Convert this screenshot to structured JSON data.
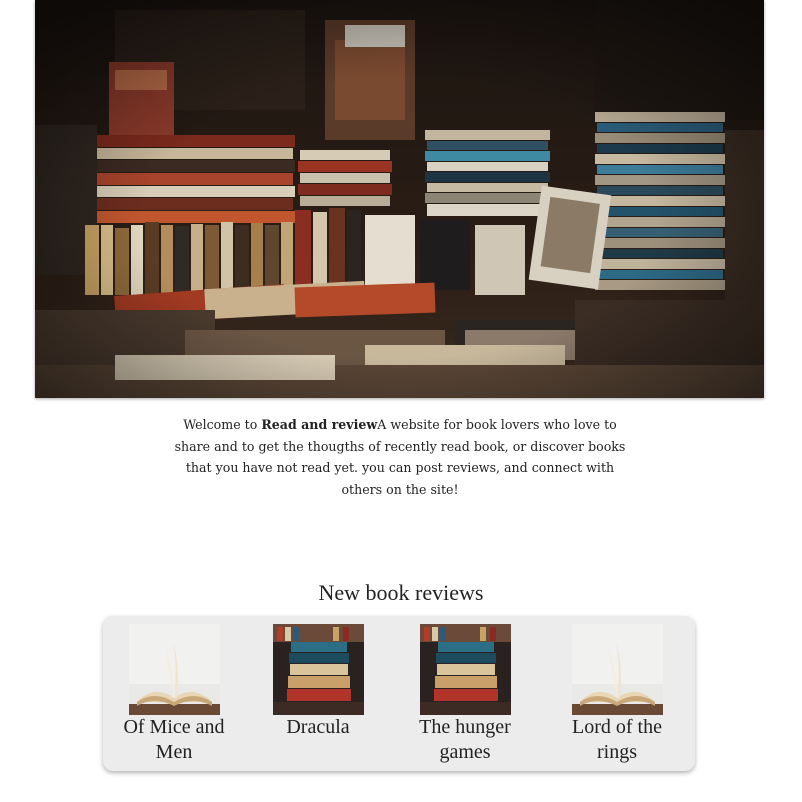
{
  "intro": {
    "prefix": "Welcome to ",
    "site_name": "Read and review",
    "text": "A website for book lovers who love to share and to get the thougths of recently read book, or discover books that you have not read yet. you can post reviews, and connect with others on the site!"
  },
  "hero": {
    "image": "bookstore-photo"
  },
  "reviews": {
    "heading": "New book reviews",
    "books": [
      {
        "title": "Of Mice and Men",
        "image": "open-book-photo"
      },
      {
        "title": "Dracula",
        "image": "book-stack-photo"
      },
      {
        "title": "The hunger games",
        "image": "book-stack-photo"
      },
      {
        "title": "Lord of the rings",
        "image": "open-book-photo"
      }
    ]
  },
  "colors": {
    "card_background": "#ececec",
    "text": "#222222"
  }
}
